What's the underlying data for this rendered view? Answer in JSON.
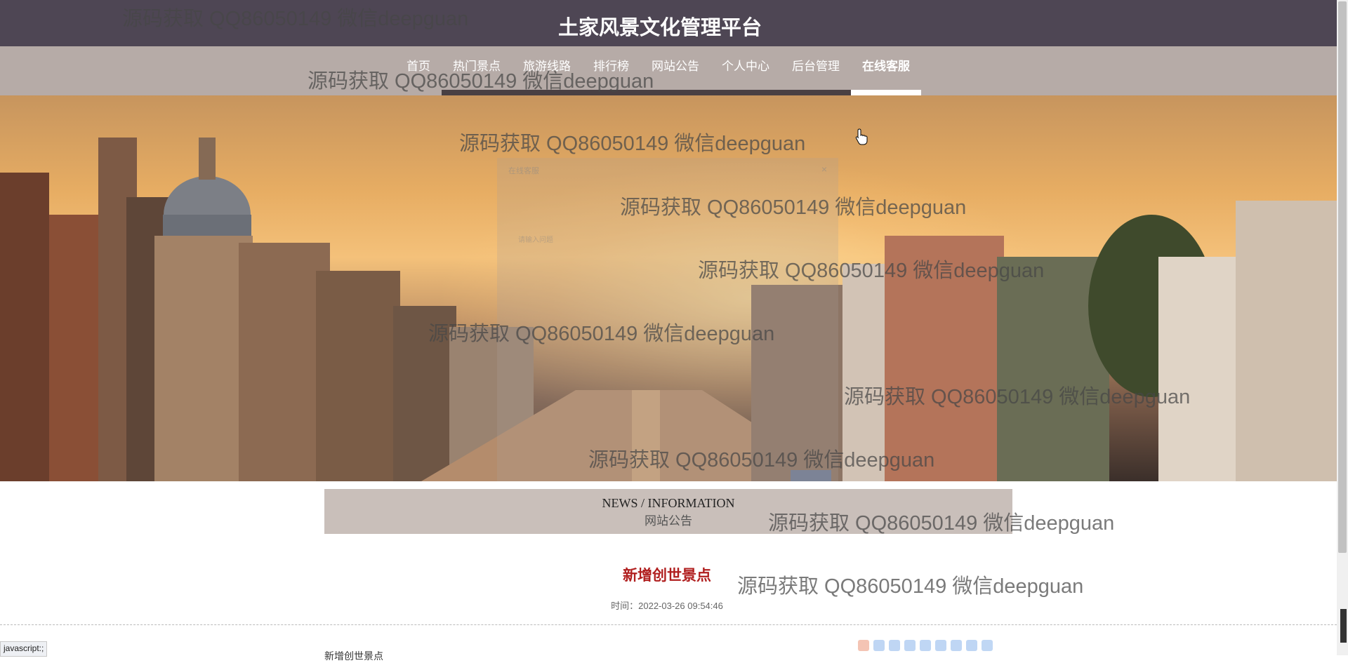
{
  "app": {
    "title": "土家风景文化管理平台"
  },
  "nav": {
    "items": [
      {
        "label": "首页"
      },
      {
        "label": "热门景点"
      },
      {
        "label": "旅游线路"
      },
      {
        "label": "排行榜"
      },
      {
        "label": "网站公告"
      },
      {
        "label": "个人中心"
      },
      {
        "label": "后台管理"
      },
      {
        "label": "在线客服",
        "active": true
      }
    ]
  },
  "chat_modal": {
    "title": "在线客服",
    "close": "×",
    "input_placeholder": "请输入问题"
  },
  "notice_section": {
    "heading_en": "NEWS / INFORMATION",
    "heading_cn": "网站公告"
  },
  "article": {
    "title": "新增创世景点",
    "time": "时间：2022-03-26 09:54:46",
    "content_preview": "新增创世景点"
  },
  "status_bar": {
    "url": "javascript:;"
  },
  "watermark_text": "源码获取 QQ86050149 微信deepguan",
  "colors": {
    "topbar": "#4e4654",
    "navbar": "#b6aba7",
    "nav_underline": "#494043",
    "active_underline": "#ffffff",
    "notice_bar": "#c9bfba",
    "news_title": "#b01e1e"
  },
  "icons": {
    "cursor": "hand-pointer-icon",
    "ime": "ime-toolbar-icon"
  }
}
